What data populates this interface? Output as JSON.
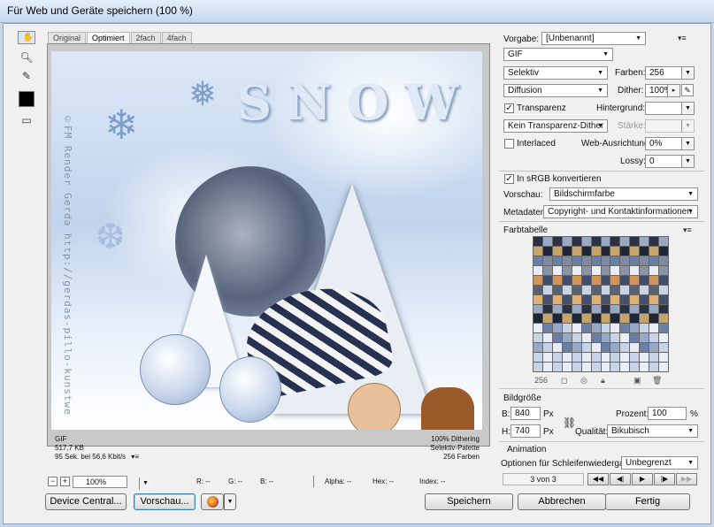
{
  "window": {
    "title": "Für Web und Geräte speichern (100 %)"
  },
  "tabs": [
    "Original",
    "Optimiert",
    "2fach",
    "4fach"
  ],
  "tools": [
    "hand-tool",
    "slice-select-tool",
    "zoom-tool",
    "eyedropper-tool"
  ],
  "canvas": {
    "snow_text": "SNOW",
    "watermark": "©FM Render Gerda http://gerdas-pillo-kunstwe"
  },
  "info": {
    "format": "GIF",
    "size": "517,7 KB",
    "time": "95 Sek. bei 56,6 Kbit/s",
    "menu": "▾≡",
    "dither": "100% Dithering",
    "palette": "Selektiv-Palette",
    "colors": "256 Farben"
  },
  "readout": {
    "zoom": "100%",
    "minus": "−",
    "plus": "+",
    "r": "R: --",
    "g": "G: --",
    "b": "B: --",
    "alpha": "Alpha: --",
    "hex": "Hex: --",
    "index": "Index: --"
  },
  "footer": {
    "device_central": "Device Central...",
    "preview": "Vorschau...",
    "save": "Speichern",
    "cancel": "Abbrechen",
    "done": "Fertig"
  },
  "settings": {
    "preset_label": "Vorgabe:",
    "preset_value": "[Unbenannt]",
    "format_value": "GIF",
    "reduction_value": "Selektiv",
    "colors_label": "Farben:",
    "colors_value": "256",
    "dither_algo": "Diffusion",
    "dither_label": "Dither:",
    "dither_value": "100%",
    "transparency_label": "Transparenz",
    "transparency_checked": "✓",
    "matte_label": "Hintergrund:",
    "trans_dither": "Kein Transparenz-Dither",
    "amount_label": "Stärke:",
    "interlaced_label": "Interlaced",
    "websnap_label": "Web-Ausrichtung:",
    "websnap_value": "0%",
    "lossy_label": "Lossy:",
    "lossy_value": "0",
    "srgb_label": "In sRGB konvertieren",
    "srgb_checked": "✓",
    "preview_label": "Vorschau:",
    "preview_value": "Bildschirmfarbe",
    "metadata_label": "Metadaten:",
    "metadata_value": "Copyright- und Kontaktinformationen"
  },
  "color_table": {
    "title": "Farbtabelle",
    "count": "256",
    "colors": [
      "#2b3140",
      "#5a6272",
      "#8a93a4",
      "#c9a46a",
      "#e0b070",
      "#3e4e6c",
      "#6a7fa6",
      "#98a9c8",
      "#c7d3e6",
      "#e9eef6",
      "#1e2536",
      "#47506a",
      "#d49356",
      "#7f8aa0"
    ]
  },
  "image_size": {
    "title": "Bildgröße",
    "w_label": "B:",
    "w_value": "840",
    "w_unit": "Px",
    "h_label": "H:",
    "h_value": "740",
    "h_unit": "Px",
    "percent_label": "Prozent:",
    "percent_value": "100",
    "percent_unit": "%",
    "quality_label": "Qualität:",
    "quality_value": "Bikubisch"
  },
  "animation": {
    "title": "Animation",
    "loop_label": "Optionen für Schleifenwiedergabe:",
    "loop_value": "Unbegrenzt",
    "frame_counter": "3 von 3",
    "nav": [
      "◀◀",
      "◀|",
      "▶",
      "|▶",
      "▶▶"
    ]
  },
  "colors": {
    "accent": "#3c7fb1",
    "panel_bg": "#f0f0f0",
    "titlebar": "#c6d8ee"
  }
}
